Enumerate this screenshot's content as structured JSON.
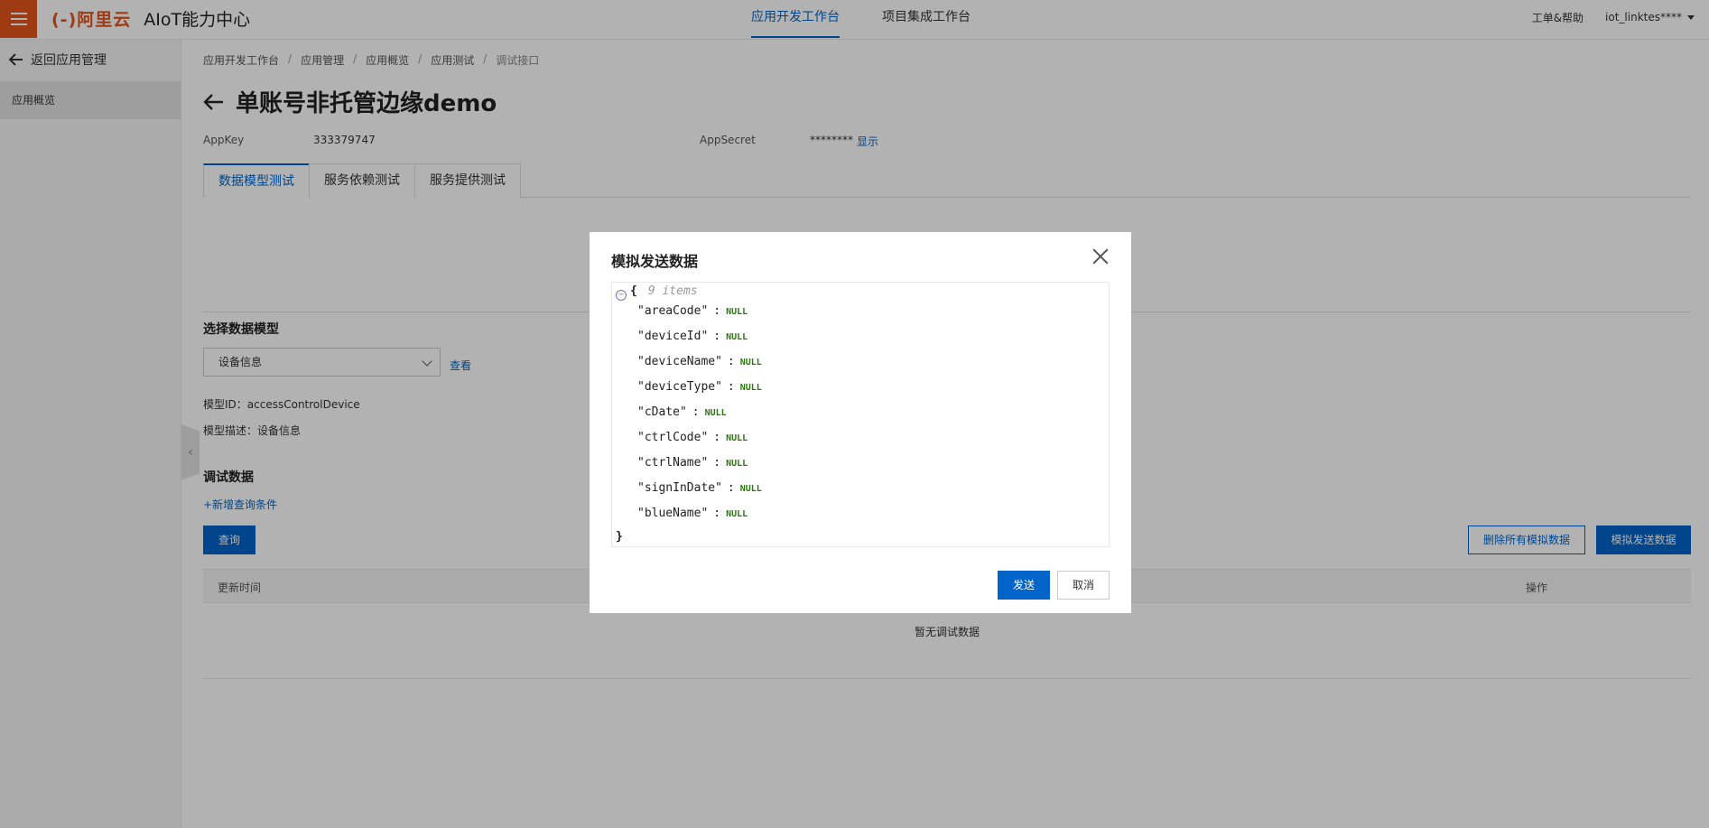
{
  "topbar": {
    "brand_mark": "(-)阿里云",
    "product": "AIoT能力中心",
    "nav": [
      "应用开发工作台",
      "项目集成工作台"
    ],
    "help": "工单&帮助",
    "user": "iot_linktes****"
  },
  "sidebar": {
    "back_label": "返回应用管理",
    "items": [
      "应用概览"
    ]
  },
  "breadcrumb": [
    "应用开发工作台",
    "应用管理",
    "应用概览",
    "应用测试",
    "调试接口"
  ],
  "page_title": "单账号非托管边缘demo",
  "appkey": {
    "label": "AppKey",
    "value": "333379747"
  },
  "appsecret": {
    "label": "AppSecret",
    "value": "********",
    "show_label": "显示"
  },
  "tabs": [
    "数据模型测试",
    "服务依赖测试",
    "服务提供测试"
  ],
  "model_section": {
    "title": "选择数据模型",
    "select_value": "设备信息",
    "view_label": "查看",
    "model_id_label": "模型ID：",
    "model_id": "accessControlDevice",
    "model_desc_label": "模型描述：",
    "model_desc": "设备信息"
  },
  "debug_section": {
    "title": "调试数据",
    "add_condition": "+新增查询条件",
    "query_button": "查询",
    "delete_all_button": "删除所有模拟数据",
    "simulate_button": "模拟发送数据",
    "columns": [
      "更新时间",
      "操作"
    ],
    "empty_text": "暂无调试数据"
  },
  "modal": {
    "title": "模拟发送数据",
    "open_brace": "{",
    "close_brace": "}",
    "item_count": "9 items",
    "fields": [
      {
        "key": "\"areaCode\"",
        "value": "NULL"
      },
      {
        "key": "\"deviceId\"",
        "value": "NULL"
      },
      {
        "key": "\"deviceName\"",
        "value": "NULL"
      },
      {
        "key": "\"deviceType\"",
        "value": "NULL"
      },
      {
        "key": "\"cDate\"",
        "value": "NULL"
      },
      {
        "key": "\"ctrlCode\"",
        "value": "NULL"
      },
      {
        "key": "\"ctrlName\"",
        "value": "NULL"
      },
      {
        "key": "\"signInDate\"",
        "value": "NULL"
      },
      {
        "key": "\"blueName\"",
        "value": "NULL"
      }
    ],
    "colon": ":",
    "send_button": "发送",
    "cancel_button": "取消"
  },
  "colors": {
    "accent": "#0064c8",
    "brand": "#e2551c",
    "null_value": "#2b7a0b"
  }
}
